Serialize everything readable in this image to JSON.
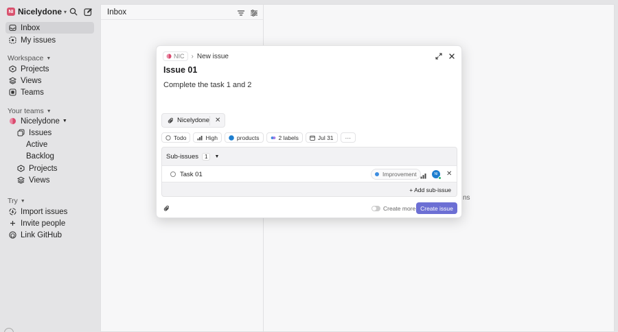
{
  "sidebar": {
    "workspace": {
      "badge": "NI",
      "name": "Nicelydone"
    },
    "items": [
      {
        "label": "Inbox"
      },
      {
        "label": "My issues"
      }
    ],
    "workspace_section": {
      "label": "Workspace",
      "items": [
        {
          "label": "Projects"
        },
        {
          "label": "Views"
        },
        {
          "label": "Teams"
        }
      ]
    },
    "teams_section": {
      "label": "Your teams",
      "team": "Nicelydone",
      "items": [
        {
          "label": "Issues"
        },
        {
          "label": "Active"
        },
        {
          "label": "Backlog"
        },
        {
          "label": "Projects"
        },
        {
          "label": "Views"
        }
      ]
    },
    "try_section": {
      "label": "Try",
      "items": [
        {
          "label": "Import issues"
        },
        {
          "label": "Invite people"
        },
        {
          "label": "Link GitHub"
        }
      ]
    }
  },
  "inbox": {
    "title": "Inbox"
  },
  "background": {
    "partial_text": "ns"
  },
  "modal": {
    "team_key": "NIC",
    "breadcrumb_title": "New issue",
    "title": "Issue 01",
    "description": "Complete the task 1 and 2",
    "team_chip": "Nicelydone",
    "properties": {
      "status": "Todo",
      "priority": "High",
      "project": "products",
      "labels": "2 labels",
      "due_date": "Jul 31",
      "more": "···"
    },
    "subissues": {
      "label": "Sub-issues",
      "count": "1",
      "items": [
        {
          "title": "Task 01",
          "label": "Improvement",
          "avatar": "NI"
        }
      ],
      "add_label": "+ Add sub-issue"
    },
    "footer": {
      "create_more": "Create more",
      "create_button": "Create issue"
    }
  },
  "colors": {
    "accent": "#6c6fd4",
    "workspace_badge": "#d9526e",
    "label_dot": "#3d8de0",
    "avatar": "#1d7ecf"
  }
}
